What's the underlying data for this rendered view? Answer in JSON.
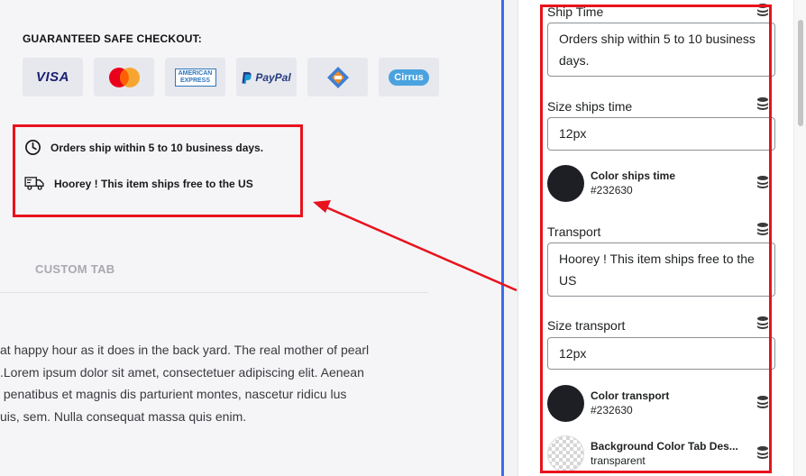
{
  "preview": {
    "checkout_title": "GUARANTEED SAFE CHECKOUT:",
    "payment_methods": [
      {
        "name": "visa-icon",
        "label": "VISA"
      },
      {
        "name": "mastercard-icon",
        "label": ""
      },
      {
        "name": "amex-icon",
        "label": "AMERICAN EXPRESS"
      },
      {
        "name": "paypal-icon",
        "label": "PayPal"
      },
      {
        "name": "discover-icon",
        "label": ""
      },
      {
        "name": "cirrus-icon",
        "label": "Cirrus"
      }
    ],
    "ship_time_text": "Orders ship within 5 to 10 business days.",
    "transport_text": "Hoorey ! This item ships free to the US",
    "custom_tab_label": "CUSTOM TAB",
    "description_lines": [
      "at happy hour as it does in the back yard. The real mother of pearl",
      ".Lorem ipsum dolor sit amet, consectetuer adipiscing elit. Aenean",
      " penatibus et magnis dis parturient montes, nascetur ridicu lus",
      "uis, sem. Nulla consequat massa quis enim."
    ]
  },
  "settings": {
    "ship_time": {
      "label": "Ship Time",
      "value": "Orders ship within 5 to 10 business days."
    },
    "size_ships_time": {
      "label": "Size ships time",
      "value": "12px"
    },
    "color_ships_time": {
      "label": "Color ships time",
      "value": "#232630"
    },
    "transport": {
      "label": "Transport",
      "value": "Hoorey ! This item ships free to the US"
    },
    "size_transport": {
      "label": "Size transport",
      "value": "12px"
    },
    "color_transport": {
      "label": "Color transport",
      "value": "#232630"
    },
    "bg_color_tab": {
      "label": "Background Color Tab Des...",
      "value": "transparent"
    }
  },
  "colors": {
    "highlight": "#e8131c",
    "divider": "#3b6cf0",
    "swatch": "#1d1f25"
  }
}
